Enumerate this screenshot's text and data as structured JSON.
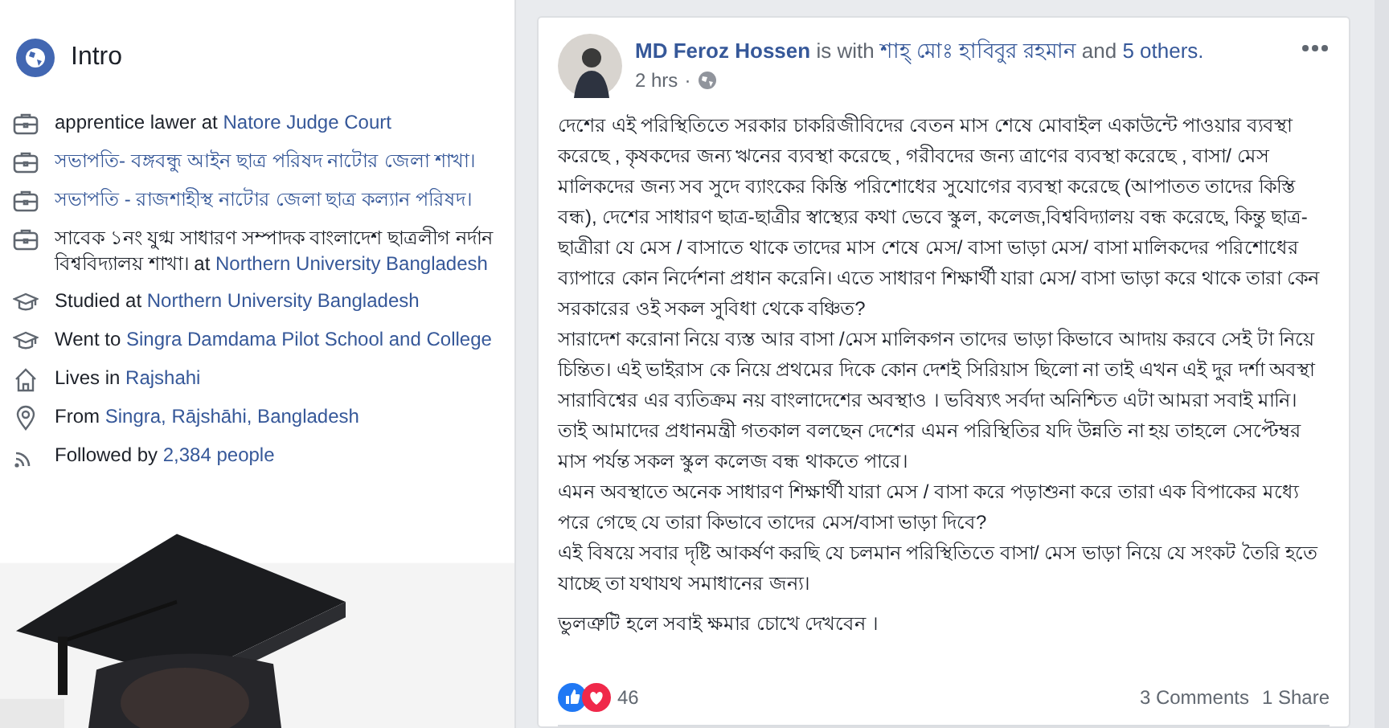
{
  "intro": {
    "title": "Intro",
    "items": [
      {
        "kind": "work",
        "prefix": "apprentice lawer at ",
        "link": "Natore Judge Court"
      },
      {
        "kind": "work",
        "link": "সভাপতি- বঙ্গবন্ধু আইন ছাত্র পরিষদ নাটোর জেলা শাখা।"
      },
      {
        "kind": "work",
        "link": "সভাপতি - রাজশাহীস্থ নাটোর জেলা ছাত্র কল্যান পরিষদ।"
      },
      {
        "kind": "work",
        "prefix": "সাবেক ১নং যুগ্ম সাধারণ সম্পাদক বাংলাদেশ ছাত্রলীগ নর্দান বিশ্ববিদ্যালয় শাখা। at ",
        "link": "Northern University Bangladesh"
      },
      {
        "kind": "education",
        "prefix": "Studied at ",
        "link": "Northern University Bangladesh"
      },
      {
        "kind": "education",
        "prefix": "Went to ",
        "link": "Singra Damdama Pilot School and College"
      },
      {
        "kind": "home",
        "prefix": "Lives in ",
        "link": "Rajshahi"
      },
      {
        "kind": "location",
        "prefix": "From ",
        "link": "Singra, Rājshāhi, Bangladesh"
      },
      {
        "kind": "followers",
        "prefix": "Followed by ",
        "link": "2,384 people"
      }
    ]
  },
  "post": {
    "author": "MD Feroz Hossen",
    "with_text": " is with ",
    "tagged": "শাহ্ মোঃ হাবিবুর রহমান",
    "and_text": " and ",
    "others": "5 others.",
    "time": "2 hrs",
    "separator": "·",
    "paragraphs": [
      "দেশের এই পরিস্থিতিতে সরকার চাকরিজীবিদের বেতন মাস শেষে মোবাইল একাউন্টে পাওয়ার ব্যবস্থা করেছে , কৃষকদের জন্য ঋনের ব্যবস্থা করেছে , গরীবদের জন্য ত্রাণের ব্যবস্থা করেছে , বাসা/ মেস মালিকদের জন্য সব সুদে ব্যাংকের কিস্তি পরিশোধের সুযোগের ব্যবস্থা করেছে (আপাতত তাদের কিস্তি বন্ধ), দেশের সাধারণ ছাত্র-ছাত্রীর স্বাস্থ্যের কথা ভেবে স্কুল, কলেজ,বিশ্ববিদ্যালয় বন্ধ করেছে, কিন্তু ছাত্র-ছাত্রীরা যে মেস / বাসাতে থাকে তাদের মাস শেষে মেস/ বাসা ভাড়া মেস/ বাসা মালিকদের পরিশোধের ব্যাপারে কোন নির্দেশনা প্রধান করেনি। এতে সাধারণ শিক্ষার্থী যারা মেস/ বাসা ভাড়া করে থাকে তারা কেন সরকারের ওই সকল সুবিধা থেকে বঞ্চিত?",
      "সারাদেশ করোনা নিয়ে ব্যস্ত আর বাসা /মেস মালিকগন তাদের ভাড়া কিভাবে আদায় করবে সেই টা নিয়ে চিন্তিত। এই ভাইরাস কে নিয়ে প্রথমের দিকে কোন দেশই সিরিয়াস ছিলো না তাই এখন এই দুর দর্শা অবস্থা সারাবিশ্বের এর ব্যতিক্রম নয় বাংলাদেশের অবস্থাও । ভবিষ্যৎ সর্বদা অনিশ্চিত এটা আমরা সবাই মানি। তাই আমাদের প্রধানমন্ত্রী গতকাল বলছেন দেশের এমন পরিস্থিতির যদি উন্নতি না হয় তাহলে সেপ্টেম্বর মাস পর্যন্ত সকল স্কুল কলেজ বন্ধ থাকতে পারে।",
      "এমন অবস্থাতে অনেক সাধারণ শিক্ষার্থী যারা মেস / বাসা করে পড়াশুনা করে তারা এক বিপাকের মধ্যে পরে গেছে যে তারা কিভাবে তাদের মেস/বাসা ভাড়া দিবে?",
      "এই বিষয়ে সবার দৃষ্টি আকর্ষণ করছি যে চলমান পরিস্থিতিতে বাসা/ মেস ভাড়া নিয়ে যে সংকট তৈরি হতে যাচ্ছে তা যথাযথ সমাধানের জন্য।"
    ],
    "closing": "ভুলত্রুটি হলে সবাই ক্ষমার চোখে দেখবেন ।",
    "reaction_count": "46",
    "comments": "3 Comments",
    "shares": "1 Share"
  }
}
